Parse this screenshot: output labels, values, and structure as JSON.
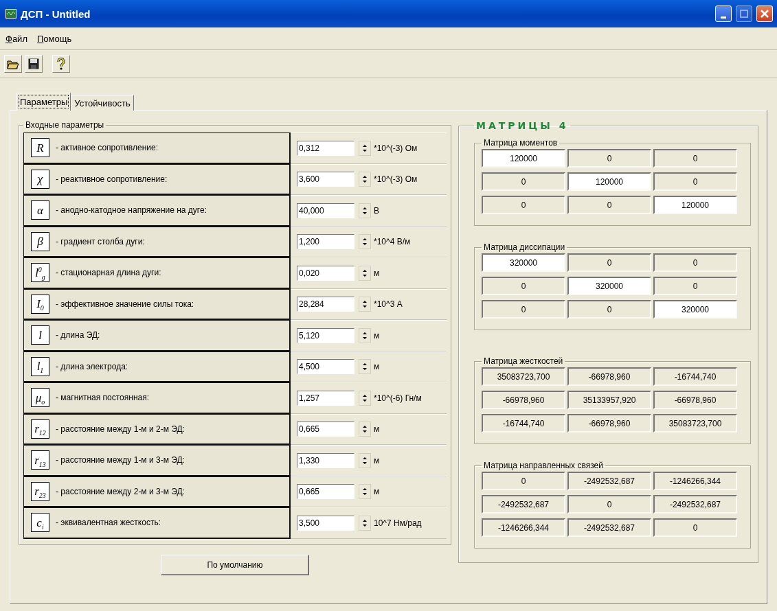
{
  "window": {
    "title": "ДСП - Untitled"
  },
  "menu": [
    {
      "label": "Файл"
    },
    {
      "label": "Помощь"
    }
  ],
  "toolbar": [
    {
      "kind": "open"
    },
    {
      "kind": "save"
    },
    {
      "kind": "help"
    }
  ],
  "tabs": [
    {
      "label": "Параметры",
      "selected": true
    },
    {
      "label": "Устойчивость",
      "selected": false
    }
  ],
  "inputs": {
    "title": "Входные параметры",
    "rows": [
      {
        "symbol": "R",
        "label": "- активное сопротивление:",
        "value": "0,312",
        "unit": "*10^(-3) Ом"
      },
      {
        "symbol": "χ",
        "label": "- реактивное сопротивление:",
        "value": "3,600",
        "unit": "*10^(-3) Ом"
      },
      {
        "symbol": "α",
        "label": "- анодно-катодное напряжение на дуге:",
        "value": "40,000",
        "unit": "В"
      },
      {
        "symbol": "β",
        "label": "- градиент столба дуги:",
        "value": "1,200",
        "unit": "*10^4 В/м"
      },
      {
        "symbol": "l$^{0}$$_{g}$",
        "label": "- стационарная длина дуги:",
        "value": "0,020",
        "unit": "м"
      },
      {
        "symbol": "I$_{0}$",
        "label": "- эффективное значение силы тока:",
        "value": "28,284",
        "unit": "*10^3 А"
      },
      {
        "symbol": "l",
        "label": "- длина ЭД:",
        "value": "5,120",
        "unit": "м"
      },
      {
        "symbol": "l$_{1}$",
        "label": "- длина электрода:",
        "value": "4,500",
        "unit": "м"
      },
      {
        "symbol": "μ$_{o}$",
        "label": "- магнитная постоянная:",
        "value": "1,257",
        "unit": "*10^(-6) Гн/м"
      },
      {
        "symbol": "r$_{12}$",
        "label": "- расстояние между 1-м и 2-м ЭД:",
        "value": "0,665",
        "unit": "м"
      },
      {
        "symbol": "r$_{13}$",
        "label": "- расстояние между 1-м и 3-м ЭД:",
        "value": "1,330",
        "unit": "м"
      },
      {
        "symbol": "r$_{23}$",
        "label": "- расстояние между 2-м и 3-м ЭД:",
        "value": "0,665",
        "unit": "м"
      },
      {
        "symbol": "c$_{i}$",
        "label": "- эквивалентная жесткость:",
        "value": "3,500",
        "unit": "10^7 Нм/рад"
      }
    ],
    "default_button": "По умолчанию"
  },
  "matrices": {
    "title": "МАТРИЦЫ 4",
    "groups": [
      {
        "title": "Матрица моментов",
        "rows": [
          [
            {
              "value": "120000",
              "editable": true
            },
            {
              "value": "0",
              "editable": false
            },
            {
              "value": "0",
              "editable": false
            }
          ],
          [
            {
              "value": "0",
              "editable": false
            },
            {
              "value": "120000",
              "editable": true
            },
            {
              "value": "0",
              "editable": false
            }
          ],
          [
            {
              "value": "0",
              "editable": false
            },
            {
              "value": "0",
              "editable": false
            },
            {
              "value": "120000",
              "editable": true
            }
          ]
        ]
      },
      {
        "title": "Матрица диссипации",
        "rows": [
          [
            {
              "value": "320000",
              "editable": true
            },
            {
              "value": "0",
              "editable": false
            },
            {
              "value": "0",
              "editable": false
            }
          ],
          [
            {
              "value": "0",
              "editable": false
            },
            {
              "value": "320000",
              "editable": true
            },
            {
              "value": "0",
              "editable": false
            }
          ],
          [
            {
              "value": "0",
              "editable": false
            },
            {
              "value": "0",
              "editable": false
            },
            {
              "value": "320000",
              "editable": true
            }
          ]
        ]
      },
      {
        "title": "Матрица жесткостей",
        "rows": [
          [
            {
              "value": "35083723,700",
              "editable": false
            },
            {
              "value": "-66978,960",
              "editable": false
            },
            {
              "value": "-16744,740",
              "editable": false
            }
          ],
          [
            {
              "value": "-66978,960",
              "editable": false
            },
            {
              "value": "35133957,920",
              "editable": false
            },
            {
              "value": "-66978,960",
              "editable": false
            }
          ],
          [
            {
              "value": "-16744,740",
              "editable": false
            },
            {
              "value": "-66978,960",
              "editable": false
            },
            {
              "value": "35083723,700",
              "editable": false
            }
          ]
        ]
      },
      {
        "title": "Матрица направленных связей",
        "rows": [
          [
            {
              "value": "0",
              "editable": false
            },
            {
              "value": "-2492532,687",
              "editable": false
            },
            {
              "value": "-1246266,344",
              "editable": false
            }
          ],
          [
            {
              "value": "-2492532,687",
              "editable": false
            },
            {
              "value": "0",
              "editable": false
            },
            {
              "value": "-2492532,687",
              "editable": false
            }
          ],
          [
            {
              "value": "-1246266,344",
              "editable": false
            },
            {
              "value": "-2492532,687",
              "editable": false
            },
            {
              "value": "0",
              "editable": false
            }
          ]
        ]
      }
    ]
  }
}
